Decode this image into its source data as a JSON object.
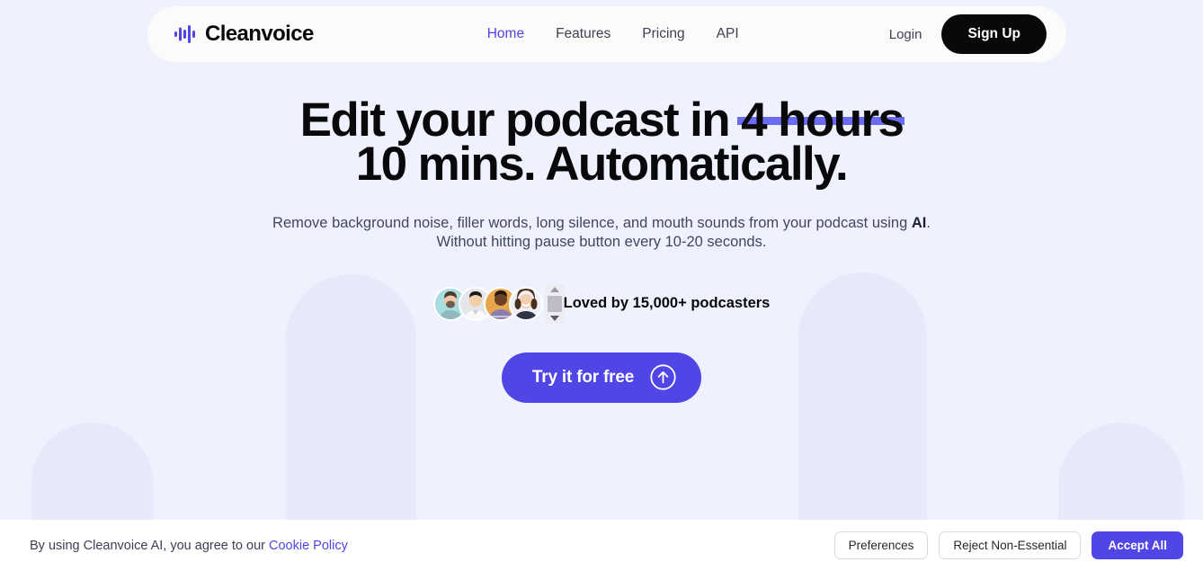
{
  "colors": {
    "page_background": "#eff2fe",
    "arch": "#e7e8fa",
    "accent_indigo": "#4f46e5",
    "strike_bar": "#6b6bf2",
    "header_background": "#fbfbfa",
    "signup_black": "#09090b"
  },
  "header": {
    "brand_name": "Cleanvoice",
    "logo_icon": "waveform-icon",
    "nav": [
      {
        "label": "Home",
        "active": true
      },
      {
        "label": "Features",
        "active": false
      },
      {
        "label": "Pricing",
        "active": false
      },
      {
        "label": "API",
        "active": false
      }
    ],
    "login_label": "Login",
    "signup_label": "Sign Up"
  },
  "hero": {
    "headline_part_1": "Edit your podcast in ",
    "headline_struck": "4 hours",
    "headline_line_2": "10 mins. Automatically.",
    "subtitle_part_1": "Remove background noise, filler words, long silence, and mouth sounds from your podcast using ",
    "subtitle_bold": "AI",
    "subtitle_part_2": ".",
    "subtitle_line_2": "Without hitting pause button every 10-20 seconds.",
    "social_proof_text": "Loved by 15,000+ podcasters",
    "avatar_count": 4,
    "broken_image_icon": "broken-image-scrollbar-icon",
    "cta_label": "Try it for free",
    "cta_icon": "arrow-up-circle-icon"
  },
  "cookie_banner": {
    "text_prefix": "By using Cleanvoice AI, you agree to our ",
    "policy_link_label": "Cookie Policy",
    "preferences_label": "Preferences",
    "reject_label": "Reject Non-Essential",
    "accept_label": "Accept All"
  }
}
